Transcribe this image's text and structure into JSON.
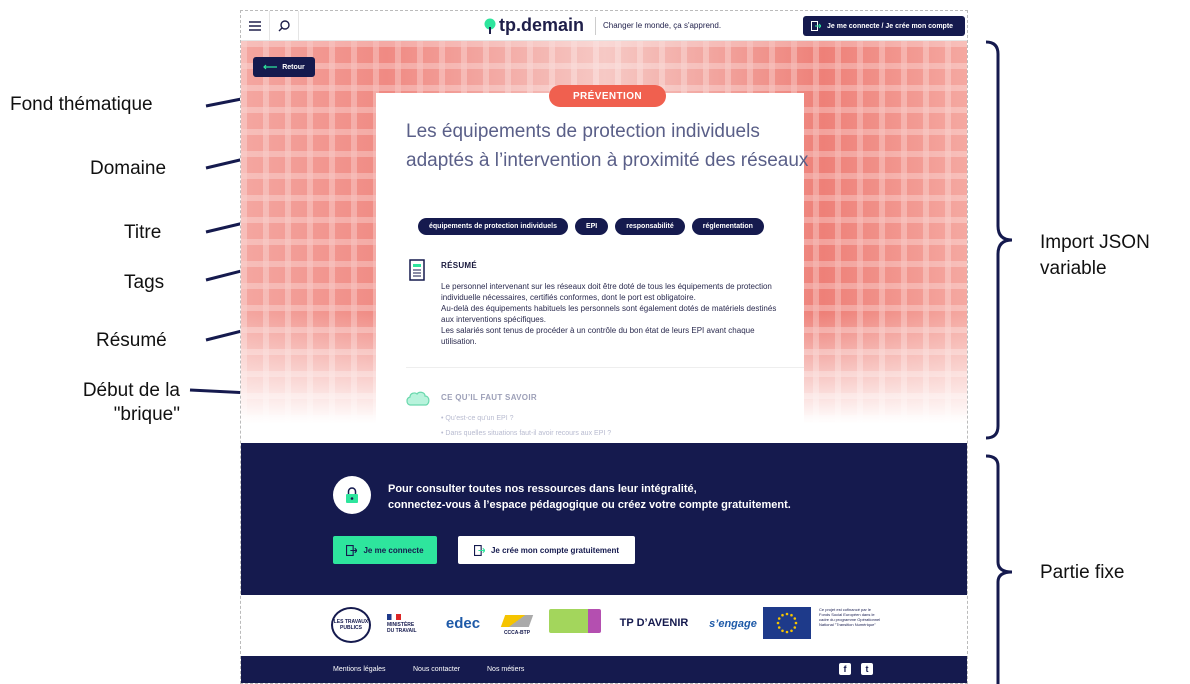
{
  "annotations": {
    "left": [
      "Fond thématique",
      "Domaine",
      "Titre",
      "Tags",
      "Résumé",
      "Début de la",
      "\"brique\""
    ],
    "right": {
      "import_line1": "Import JSON",
      "import_line2": "variable",
      "fixed": "Partie fixe"
    }
  },
  "header": {
    "logo_text": "tp.demain",
    "slogan": "Changer le monde, ça s'apprend.",
    "login_button": "Je me connecte / Je crée mon compte",
    "menu_icon": "hamburger-icon",
    "search_icon": "search-icon"
  },
  "hero": {
    "back_button": "Retour",
    "domain": "PRÉVENTION",
    "title": "Les équipements de protection individuels adaptés à l’intervention à proximité des réseaux",
    "tags": [
      "équipements de protection individuels",
      "EPI",
      "responsabilité",
      "réglementation"
    ]
  },
  "resume": {
    "title": "RÉSUMÉ",
    "lines": [
      "Le personnel intervenant sur les réseaux doit être doté de tous les équipements de protection",
      "individuelle nécessaires, certifiés conformes, dont le port est obligatoire.",
      "Au-delà des équipements habituels les personnels sont également dotés de matériels destinés",
      "aux interventions spécifiques.",
      "Les salariés sont tenus de procéder à un contrôle du bon état de leurs EPI avant chaque",
      "utilisation."
    ]
  },
  "brick": {
    "title": "CE QU’IL FAUT SAVOIR",
    "items": [
      "• Qu’est-ce qu’un EPI ?",
      "• Dans quelles situations faut-il avoir recours aux EPI ?"
    ]
  },
  "cta": {
    "line1": "Pour consulter toutes nos ressources dans leur intégralité,",
    "line2": "connectez-vous à l’espace pédagogique ou créez votre compte gratuitement.",
    "connect_button": "Je me connecte",
    "create_button": "Je crée mon compte gratuitement"
  },
  "partners": {
    "ltp_1": "LES TRAVAUX",
    "ltp_2": "PUBLICS",
    "ministere_1": "MINISTÈRE",
    "ministere_2": "DU TRAVAIL",
    "edec": "edec",
    "ccca": "CCCA-BTP",
    "tp_avenir": "TP D’AVENIR",
    "engage": "s’engage",
    "europe_text": "Ce projet est cofinancé par le Fonds Social Européen dans le cadre du programme Opérationnel National \"Transition Numérique\""
  },
  "footer": {
    "links": [
      "Mentions légales",
      "Nous contacter",
      "Nos métiers"
    ],
    "facebook": "f",
    "twitter": "t"
  },
  "colors": {
    "navy": "#151a4e",
    "coral": "#f0604f",
    "green": "#2ee59d",
    "title_grey": "#5a5f88"
  }
}
